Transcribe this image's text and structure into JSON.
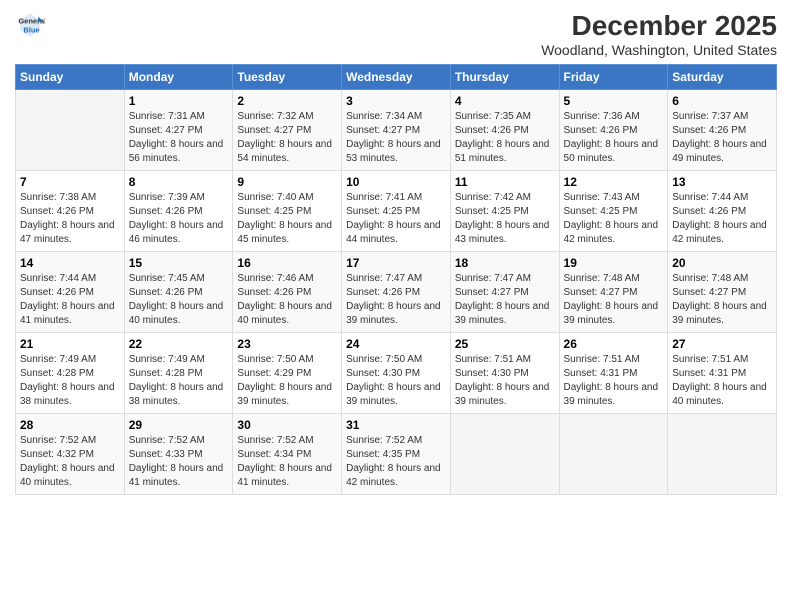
{
  "header": {
    "logo_line1": "General",
    "logo_line2": "Blue",
    "month": "December 2025",
    "location": "Woodland, Washington, United States"
  },
  "weekdays": [
    "Sunday",
    "Monday",
    "Tuesday",
    "Wednesday",
    "Thursday",
    "Friday",
    "Saturday"
  ],
  "weeks": [
    [
      {
        "day": "",
        "sunrise": "",
        "sunset": "",
        "daylight": ""
      },
      {
        "day": "1",
        "sunrise": "Sunrise: 7:31 AM",
        "sunset": "Sunset: 4:27 PM",
        "daylight": "Daylight: 8 hours and 56 minutes."
      },
      {
        "day": "2",
        "sunrise": "Sunrise: 7:32 AM",
        "sunset": "Sunset: 4:27 PM",
        "daylight": "Daylight: 8 hours and 54 minutes."
      },
      {
        "day": "3",
        "sunrise": "Sunrise: 7:34 AM",
        "sunset": "Sunset: 4:27 PM",
        "daylight": "Daylight: 8 hours and 53 minutes."
      },
      {
        "day": "4",
        "sunrise": "Sunrise: 7:35 AM",
        "sunset": "Sunset: 4:26 PM",
        "daylight": "Daylight: 8 hours and 51 minutes."
      },
      {
        "day": "5",
        "sunrise": "Sunrise: 7:36 AM",
        "sunset": "Sunset: 4:26 PM",
        "daylight": "Daylight: 8 hours and 50 minutes."
      },
      {
        "day": "6",
        "sunrise": "Sunrise: 7:37 AM",
        "sunset": "Sunset: 4:26 PM",
        "daylight": "Daylight: 8 hours and 49 minutes."
      }
    ],
    [
      {
        "day": "7",
        "sunrise": "Sunrise: 7:38 AM",
        "sunset": "Sunset: 4:26 PM",
        "daylight": "Daylight: 8 hours and 47 minutes."
      },
      {
        "day": "8",
        "sunrise": "Sunrise: 7:39 AM",
        "sunset": "Sunset: 4:26 PM",
        "daylight": "Daylight: 8 hours and 46 minutes."
      },
      {
        "day": "9",
        "sunrise": "Sunrise: 7:40 AM",
        "sunset": "Sunset: 4:25 PM",
        "daylight": "Daylight: 8 hours and 45 minutes."
      },
      {
        "day": "10",
        "sunrise": "Sunrise: 7:41 AM",
        "sunset": "Sunset: 4:25 PM",
        "daylight": "Daylight: 8 hours and 44 minutes."
      },
      {
        "day": "11",
        "sunrise": "Sunrise: 7:42 AM",
        "sunset": "Sunset: 4:25 PM",
        "daylight": "Daylight: 8 hours and 43 minutes."
      },
      {
        "day": "12",
        "sunrise": "Sunrise: 7:43 AM",
        "sunset": "Sunset: 4:25 PM",
        "daylight": "Daylight: 8 hours and 42 minutes."
      },
      {
        "day": "13",
        "sunrise": "Sunrise: 7:44 AM",
        "sunset": "Sunset: 4:26 PM",
        "daylight": "Daylight: 8 hours and 42 minutes."
      }
    ],
    [
      {
        "day": "14",
        "sunrise": "Sunrise: 7:44 AM",
        "sunset": "Sunset: 4:26 PM",
        "daylight": "Daylight: 8 hours and 41 minutes."
      },
      {
        "day": "15",
        "sunrise": "Sunrise: 7:45 AM",
        "sunset": "Sunset: 4:26 PM",
        "daylight": "Daylight: 8 hours and 40 minutes."
      },
      {
        "day": "16",
        "sunrise": "Sunrise: 7:46 AM",
        "sunset": "Sunset: 4:26 PM",
        "daylight": "Daylight: 8 hours and 40 minutes."
      },
      {
        "day": "17",
        "sunrise": "Sunrise: 7:47 AM",
        "sunset": "Sunset: 4:26 PM",
        "daylight": "Daylight: 8 hours and 39 minutes."
      },
      {
        "day": "18",
        "sunrise": "Sunrise: 7:47 AM",
        "sunset": "Sunset: 4:27 PM",
        "daylight": "Daylight: 8 hours and 39 minutes."
      },
      {
        "day": "19",
        "sunrise": "Sunrise: 7:48 AM",
        "sunset": "Sunset: 4:27 PM",
        "daylight": "Daylight: 8 hours and 39 minutes."
      },
      {
        "day": "20",
        "sunrise": "Sunrise: 7:48 AM",
        "sunset": "Sunset: 4:27 PM",
        "daylight": "Daylight: 8 hours and 39 minutes."
      }
    ],
    [
      {
        "day": "21",
        "sunrise": "Sunrise: 7:49 AM",
        "sunset": "Sunset: 4:28 PM",
        "daylight": "Daylight: 8 hours and 38 minutes."
      },
      {
        "day": "22",
        "sunrise": "Sunrise: 7:49 AM",
        "sunset": "Sunset: 4:28 PM",
        "daylight": "Daylight: 8 hours and 38 minutes."
      },
      {
        "day": "23",
        "sunrise": "Sunrise: 7:50 AM",
        "sunset": "Sunset: 4:29 PM",
        "daylight": "Daylight: 8 hours and 39 minutes."
      },
      {
        "day": "24",
        "sunrise": "Sunrise: 7:50 AM",
        "sunset": "Sunset: 4:30 PM",
        "daylight": "Daylight: 8 hours and 39 minutes."
      },
      {
        "day": "25",
        "sunrise": "Sunrise: 7:51 AM",
        "sunset": "Sunset: 4:30 PM",
        "daylight": "Daylight: 8 hours and 39 minutes."
      },
      {
        "day": "26",
        "sunrise": "Sunrise: 7:51 AM",
        "sunset": "Sunset: 4:31 PM",
        "daylight": "Daylight: 8 hours and 39 minutes."
      },
      {
        "day": "27",
        "sunrise": "Sunrise: 7:51 AM",
        "sunset": "Sunset: 4:31 PM",
        "daylight": "Daylight: 8 hours and 40 minutes."
      }
    ],
    [
      {
        "day": "28",
        "sunrise": "Sunrise: 7:52 AM",
        "sunset": "Sunset: 4:32 PM",
        "daylight": "Daylight: 8 hours and 40 minutes."
      },
      {
        "day": "29",
        "sunrise": "Sunrise: 7:52 AM",
        "sunset": "Sunset: 4:33 PM",
        "daylight": "Daylight: 8 hours and 41 minutes."
      },
      {
        "day": "30",
        "sunrise": "Sunrise: 7:52 AM",
        "sunset": "Sunset: 4:34 PM",
        "daylight": "Daylight: 8 hours and 41 minutes."
      },
      {
        "day": "31",
        "sunrise": "Sunrise: 7:52 AM",
        "sunset": "Sunset: 4:35 PM",
        "daylight": "Daylight: 8 hours and 42 minutes."
      },
      {
        "day": "",
        "sunrise": "",
        "sunset": "",
        "daylight": ""
      },
      {
        "day": "",
        "sunrise": "",
        "sunset": "",
        "daylight": ""
      },
      {
        "day": "",
        "sunrise": "",
        "sunset": "",
        "daylight": ""
      }
    ]
  ]
}
